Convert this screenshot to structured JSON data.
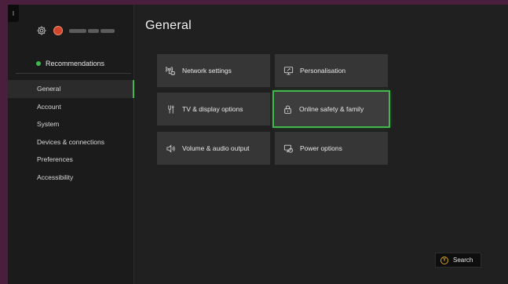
{
  "corner": {
    "label": "I"
  },
  "sidebar": {
    "recommendations": "Recommendations",
    "items": [
      {
        "label": "General",
        "active": true
      },
      {
        "label": "Account",
        "active": false
      },
      {
        "label": "System",
        "active": false
      },
      {
        "label": "Devices & connections",
        "active": false
      },
      {
        "label": "Preferences",
        "active": false
      },
      {
        "label": "Accessibility",
        "active": false
      }
    ]
  },
  "main": {
    "title": "General",
    "tiles": [
      {
        "label": "Network settings",
        "icon": "network-icon"
      },
      {
        "label": "Personalisation",
        "icon": "personalisation-icon"
      },
      {
        "label": "TV & display options",
        "icon": "display-options-icon"
      },
      {
        "label": "Online safety & family",
        "icon": "lock-icon",
        "focused": true
      },
      {
        "label": "Volume & audio output",
        "icon": "speaker-icon"
      },
      {
        "label": "Power options",
        "icon": "power-icon"
      }
    ]
  },
  "footer": {
    "search_label": "Search",
    "search_button_glyph": "Y"
  },
  "colors": {
    "accent": "#3fb84d",
    "background": "#202020",
    "tile": "#363636",
    "frame": "#4a1f3d"
  }
}
